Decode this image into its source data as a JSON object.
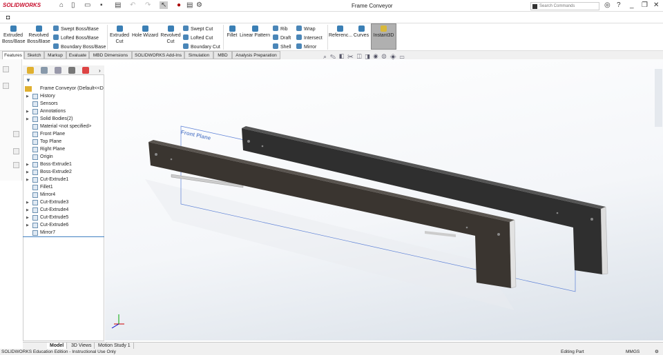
{
  "app": {
    "logo": "SOLIDWORKS",
    "title": "Frame Conveyor",
    "search_placeholder": "Search Commands"
  },
  "ribbon": {
    "extruded_boss": "Extruded Boss/Base",
    "revolved_boss": "Revolved Boss/Base",
    "swept_boss": "Swept Boss/Base",
    "lofted_boss": "Lofted Boss/Base",
    "boundary_boss": "Boundary Boss/Base",
    "extruded_cut": "Extruded Cut",
    "hole_wizard": "Hole Wizard",
    "revolved_cut": "Revolved Cut",
    "swept_cut": "Swept Cut",
    "lofted_cut": "Lofted Cut",
    "boundary_cut": "Boundary Cut",
    "fillet": "Fillet",
    "linear_pattern": "Linear Pattern",
    "rib": "Rib",
    "draft": "Draft",
    "shell": "Shell",
    "wrap": "Wrap",
    "intersect": "Intersect",
    "mirror": "Mirror",
    "reference": "Referenc...",
    "curves": "Curves",
    "instant3d": "Instant3D"
  },
  "tabs": [
    "Features",
    "Sketch",
    "Markup",
    "Evaluate",
    "MBD Dimensions",
    "SOLIDWORKS Add-Ins",
    "Simulation",
    "MBD",
    "Analysis Preparation"
  ],
  "tree": {
    "root": "Frame Conveyor  (Default<<D",
    "items": [
      {
        "label": "History",
        "exp": true
      },
      {
        "label": "Sensors",
        "exp": false
      },
      {
        "label": "Annotations",
        "exp": true
      },
      {
        "label": "Solid Bodies(2)",
        "exp": true
      },
      {
        "label": "Material <not specified>",
        "exp": false
      },
      {
        "label": "Front Plane",
        "exp": false
      },
      {
        "label": "Top Plane",
        "exp": false
      },
      {
        "label": "Right Plane",
        "exp": false
      },
      {
        "label": "Origin",
        "exp": false
      },
      {
        "label": "Boss-Extrude1",
        "exp": true
      },
      {
        "label": "Boss-Extrude2",
        "exp": true
      },
      {
        "label": "Cut-Extrude1",
        "exp": true
      },
      {
        "label": "Fillet1",
        "exp": false
      },
      {
        "label": "Mirror4",
        "exp": false
      },
      {
        "label": "Cut-Extrude3",
        "exp": true
      },
      {
        "label": "Cut-Extrude4",
        "exp": true
      },
      {
        "label": "Cut-Extrude5",
        "exp": true
      },
      {
        "label": "Cut-Extrude6",
        "exp": true
      },
      {
        "label": "Mirror7",
        "exp": false
      }
    ]
  },
  "viewport": {
    "plane_label": "Front Plane"
  },
  "bottom_tabs": [
    "Model",
    "3D Views",
    "Motion Study 1"
  ],
  "status": {
    "left": "SOLIDWORKS Education Edition - Instructional Use Only",
    "mode": "Editing Part",
    "units": "MMGS"
  }
}
